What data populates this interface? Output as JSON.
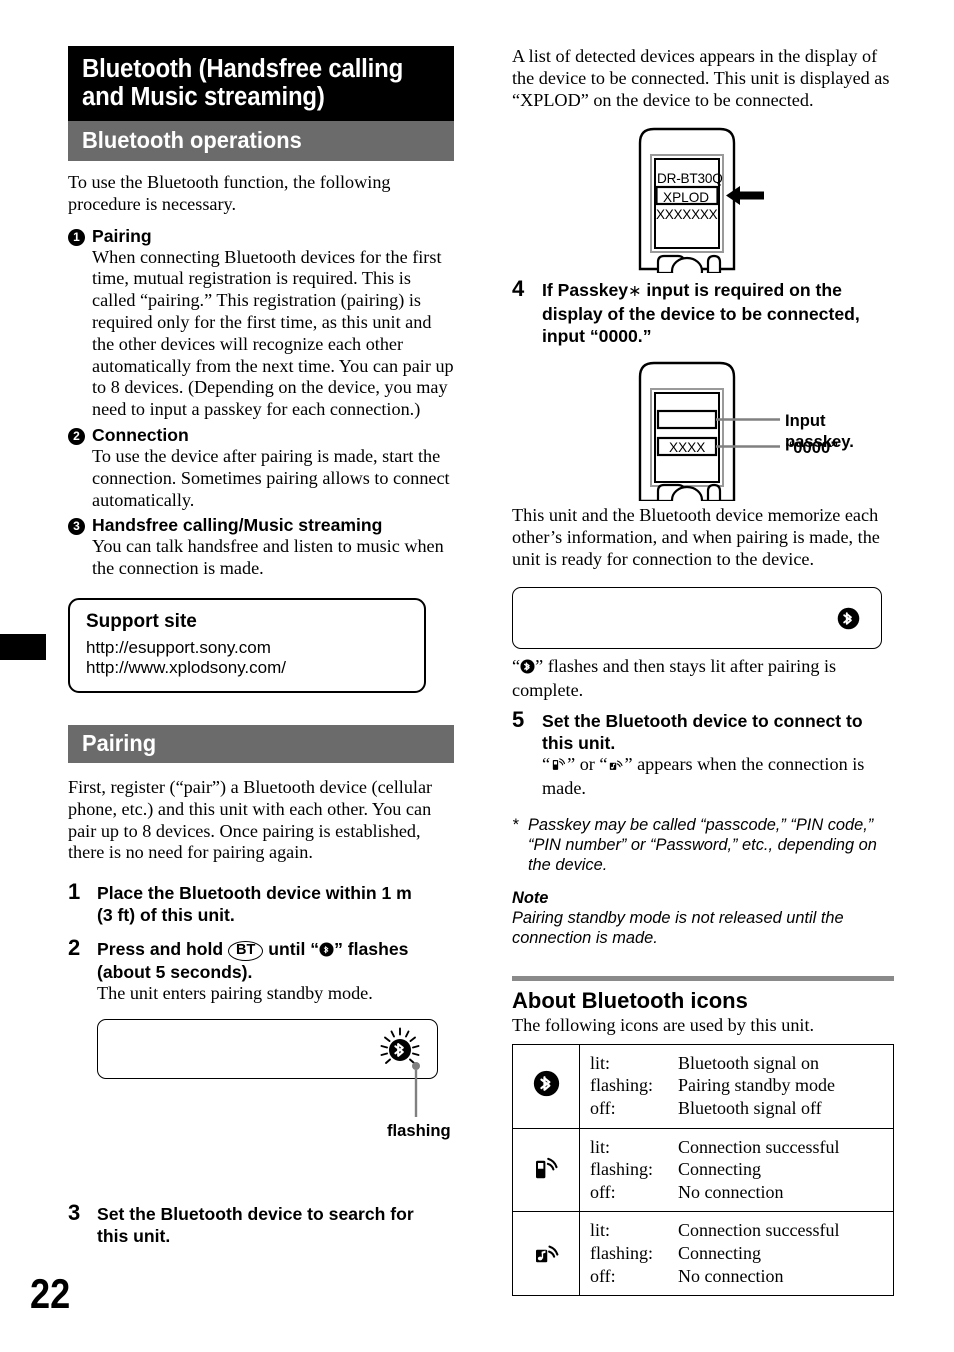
{
  "page_number": "22",
  "chapter": {
    "title_line1": "Bluetooth (Handsfree calling",
    "title_line2": "and Music streaming)",
    "section_title": "Bluetooth operations"
  },
  "intro": "To use the Bluetooth function, the following procedure is necessary.",
  "overview_items": [
    {
      "num": "1",
      "title": "Pairing",
      "body": "When connecting Bluetooth devices for the first time, mutual registration is required. This is called “pairing.” This registration (pairing) is required only for the first time, as this unit and the other devices will recognize each other automatically from the next time. You can pair up to 8 devices. (Depending on the device, you may need to input a passkey for each connection.)"
    },
    {
      "num": "2",
      "title": "Connection",
      "body": "To use the device after pairing is made, start the connection. Sometimes pairing allows to connect automatically."
    },
    {
      "num": "3",
      "title": "Handsfree calling/Music streaming",
      "body": "You can talk handsfree and listen to music when the connection is made."
    }
  ],
  "support_box": {
    "title": "Support site",
    "url1": "http://esupport.sony.com",
    "url2": "http://www.xplodsony.com/"
  },
  "pairing": {
    "heading": "Pairing",
    "intro": "First, register (“pair”) a Bluetooth device (cellular phone, etc.) and this unit with each other. You can pair up to 8 devices. Once pairing is established, there is no need for pairing again.",
    "step1": {
      "num": "1",
      "title_line1": "Place the Bluetooth device within 1 m",
      "title_line2": "(3 ft) of this unit."
    },
    "step2": {
      "num": "2",
      "title_pre": "Press and hold",
      "key_label": "BT",
      "title_mid": "until “",
      "title_post": "” flashes",
      "title_line2": "(about 5 seconds).",
      "sub": "The unit enters pairing standby mode.",
      "callout": "flashing"
    },
    "step3": {
      "num": "3",
      "title_line1": "Set the Bluetooth device to search for",
      "title_line2": "this unit."
    }
  },
  "right": {
    "detected_devices_text": "A list of detected devices appears in the display of the device to be connected. This unit is displayed as “XPLOD” on the device to be connected.",
    "phone_list": {
      "item1": "DR-BT30Q",
      "item2": "XPLOD",
      "item3": "XXXXXXX"
    },
    "step4": {
      "num": "4",
      "title_line1_pre": "If Passkey",
      "title_line1_star": "∗",
      "title_line1_post": " input is required on the",
      "title_line2": "display of the device to be connected,",
      "title_line3": "input “0000.”"
    },
    "passkey_phone": {
      "field_value": "XXXX",
      "label1": "Input passkey.",
      "label2": "“0000”"
    },
    "memorize_text": "This unit and the Bluetooth device memorize each other’s information, and when pairing is made, the unit is ready for connection to the device.",
    "flash_caption_pre": "“",
    "flash_caption_post": "” flashes and then stays lit after pairing is complete.",
    "step5": {
      "num": "5",
      "title_line1": "Set the Bluetooth device to connect to",
      "title_line2": "this unit.",
      "sub_pre": "“",
      "sub_mid": "” or “",
      "sub_post": "” appears when the connection is made."
    },
    "footnote": {
      "marker": "*",
      "text": "Passkey may be called “passcode,” “PIN code,” “PIN number” or “Password,” etc., depending on the device."
    },
    "note": {
      "label": "Note",
      "text": "Pairing standby mode is not released until the connection is made."
    },
    "icons_section": {
      "heading": "About Bluetooth icons",
      "intro": "The following icons are used by this unit.",
      "rows": [
        {
          "icon": "bluetooth-icon",
          "states": [
            "lit:",
            "flashing:",
            "off:"
          ],
          "descriptions": [
            "Bluetooth signal on",
            "Pairing standby mode",
            "Bluetooth signal off"
          ]
        },
        {
          "icon": "phone-signal-icon",
          "states": [
            "lit:",
            "flashing:",
            "off:"
          ],
          "descriptions": [
            "Connection successful",
            "Connecting",
            "No connection"
          ]
        },
        {
          "icon": "music-signal-icon",
          "states": [
            "lit:",
            "flashing:",
            "off:"
          ],
          "descriptions": [
            "Connection successful",
            "Connecting",
            "No connection"
          ]
        }
      ]
    }
  },
  "colors": {
    "chapter_bar": "#000000",
    "section_bar": "#6b6b6b",
    "rule_gray": "#8a8a8a"
  }
}
